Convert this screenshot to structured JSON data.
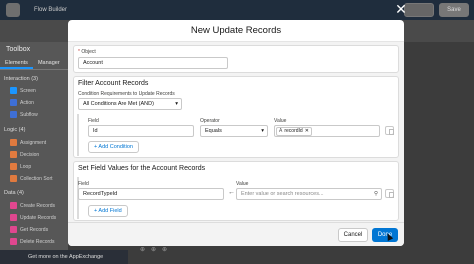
{
  "topbar": {
    "title": "Flow Builder",
    "save_label": "Save"
  },
  "toolbox": {
    "title": "Toolbox",
    "tabs": [
      "Elements",
      "Manager"
    ],
    "sections": [
      {
        "label": "Interaction (3)",
        "items": [
          "Screen",
          "Action",
          "Subflow"
        ]
      },
      {
        "label": "Logic (4)",
        "items": [
          "Assignment",
          "Decision",
          "Loop",
          "Collection Sort"
        ]
      },
      {
        "label": "Data (4)",
        "items": [
          "Create Records",
          "Update Records",
          "Get Records",
          "Delete Records"
        ]
      }
    ],
    "appexchange_label": "Get more on the AppExchange"
  },
  "modal": {
    "title": "New Update Records",
    "object": {
      "label": "* Object",
      "value": "Account"
    },
    "filter": {
      "heading": "Filter Account Records",
      "condition_label": "Condition Requirements to Update Records",
      "condition_value": "All Conditions Are Met (AND)",
      "field_label": "Field",
      "field_value": "Id",
      "operator_label": "Operator",
      "operator_value": "Equals",
      "value_label": "Value",
      "value_pill": "recordId",
      "add_condition_label": "+ Add Condition"
    },
    "set_fields": {
      "heading": "Set Field Values for the Account Records",
      "field_label": "Field",
      "field_value": "RecordTypeId",
      "value_label": "Value",
      "value_placeholder": "Enter value or search resources...",
      "add_field_label": "+ Add Field"
    },
    "footer": {
      "cancel_label": "Cancel",
      "done_label": "Done"
    }
  },
  "colors": {
    "brand": "#0176d3",
    "topbar": "#1f2d3d"
  }
}
